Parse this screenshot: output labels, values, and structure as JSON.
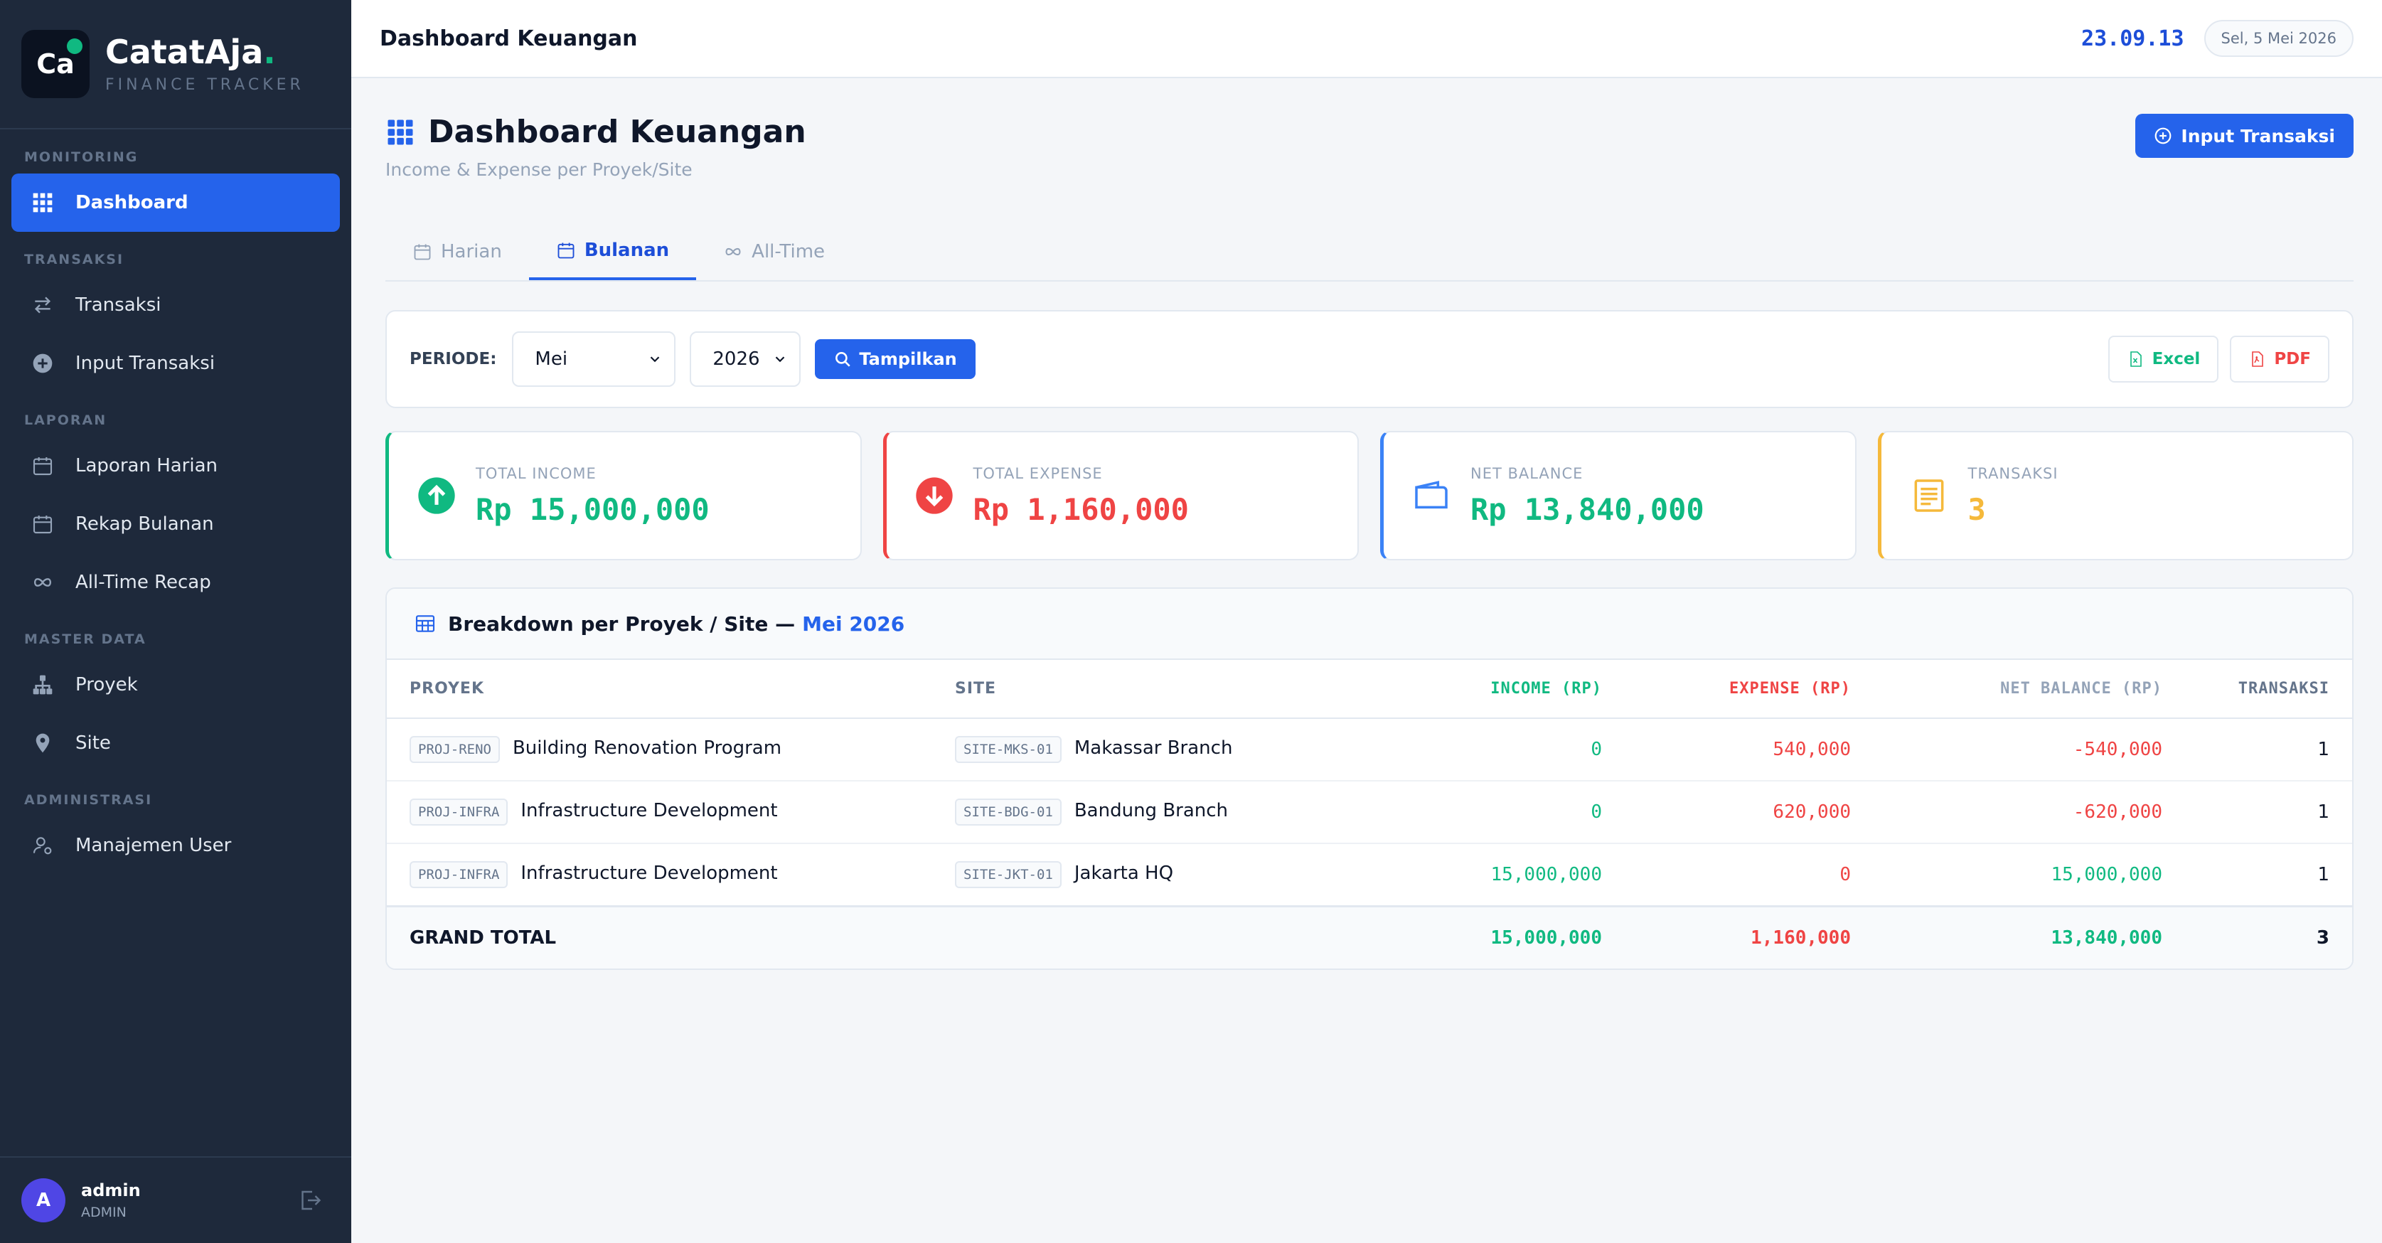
{
  "brand": {
    "logo_text": "Ca",
    "name": "CatatAja",
    "name_dot": ".",
    "tagline": "FINANCE TRACKER"
  },
  "sidebar": {
    "sections": [
      {
        "title": "MONITORING",
        "items": [
          {
            "label": "Dashboard",
            "icon": "grid-icon",
            "active": true
          }
        ]
      },
      {
        "title": "TRANSAKSI",
        "items": [
          {
            "label": "Transaksi",
            "icon": "swap-icon"
          },
          {
            "label": "Input Transaksi",
            "icon": "plus-circle-icon"
          }
        ]
      },
      {
        "title": "LAPORAN",
        "items": [
          {
            "label": "Laporan Harian",
            "icon": "calendar-icon"
          },
          {
            "label": "Rekap Bulanan",
            "icon": "calendar-icon"
          },
          {
            "label": "All-Time Recap",
            "icon": "infinity-icon"
          }
        ]
      },
      {
        "title": "MASTER DATA",
        "items": [
          {
            "label": "Proyek",
            "icon": "sitemap-icon"
          },
          {
            "label": "Site",
            "icon": "pin-icon"
          }
        ]
      },
      {
        "title": "ADMINISTRASI",
        "items": [
          {
            "label": "Manajemen User",
            "icon": "user-gear-icon"
          }
        ]
      }
    ]
  },
  "user": {
    "initial": "A",
    "name": "admin",
    "role": "ADMIN"
  },
  "topbar": {
    "title": "Dashboard Keuangan",
    "clock": "23.09.13",
    "date": "Sel, 5 Mei 2026"
  },
  "page": {
    "title": "Dashboard Keuangan",
    "subtitle": "Income & Expense per Proyek/Site",
    "primary_button": "Input Transaksi"
  },
  "tabs": [
    {
      "label": "Harian",
      "icon": "calendar-icon"
    },
    {
      "label": "Bulanan",
      "icon": "calendar-month-icon",
      "active": true
    },
    {
      "label": "All-Time",
      "icon": "infinity-icon"
    }
  ],
  "filter": {
    "label": "PERIODE:",
    "month": "Mei",
    "year": "2026",
    "show_button": "Tampilkan",
    "excel": "Excel",
    "pdf": "PDF"
  },
  "stats": [
    {
      "label": "TOTAL INCOME",
      "value": "Rp 15,000,000",
      "color": "#10b981"
    },
    {
      "label": "TOTAL EXPENSE",
      "value": "Rp 1,160,000",
      "color": "#ef4444"
    },
    {
      "label": "NET BALANCE",
      "value": "Rp 13,840,000",
      "color": "#10b981"
    },
    {
      "label": "TRANSAKSI",
      "value": "3",
      "color": "#f5b93b"
    }
  ],
  "breakdown": {
    "title": "Breakdown per Proyek / Site —",
    "period": "Mei 2026",
    "columns": {
      "proyek": "PROYEK",
      "site": "SITE",
      "income": "INCOME (RP)",
      "expense": "EXPENSE (RP)",
      "net": "NET BALANCE (RP)",
      "trx": "TRANSAKSI"
    },
    "rows": [
      {
        "proj_code": "PROJ-RENO",
        "proj_name": "Building Renovation Program",
        "site_code": "SITE-MKS-01",
        "site_name": "Makassar Branch",
        "income": "0",
        "expense": "540,000",
        "net": "-540,000",
        "trx": "1"
      },
      {
        "proj_code": "PROJ-INFRA",
        "proj_name": "Infrastructure Development",
        "site_code": "SITE-BDG-01",
        "site_name": "Bandung Branch",
        "income": "0",
        "expense": "620,000",
        "net": "-620,000",
        "trx": "1"
      },
      {
        "proj_code": "PROJ-INFRA",
        "proj_name": "Infrastructure Development",
        "site_code": "SITE-JKT-01",
        "site_name": "Jakarta HQ",
        "income": "15,000,000",
        "expense": "0",
        "net": "15,000,000",
        "trx": "1"
      }
    ],
    "total": {
      "label": "GRAND TOTAL",
      "income": "15,000,000",
      "expense": "1,160,000",
      "net": "13,840,000",
      "trx": "3"
    }
  },
  "colors": {
    "accent": "#2563eb",
    "income": "#10b981",
    "expense": "#ef4444",
    "balance": "#3b82f6",
    "transaksi": "#f5b93b",
    "sidebar": "#1e293b"
  }
}
